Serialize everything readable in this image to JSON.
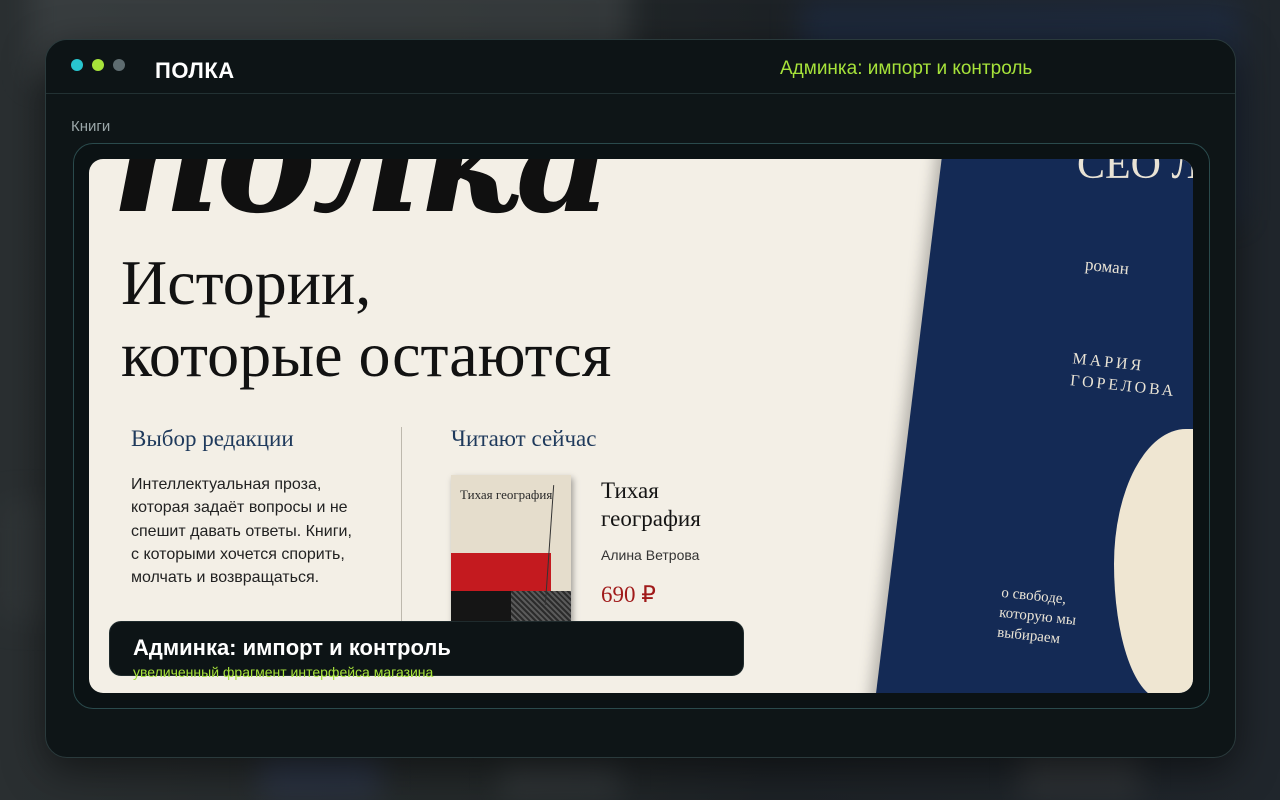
{
  "window": {
    "brand": "ПОЛКА",
    "title_right": "Админка: импорт и контроль"
  },
  "breadcrumb": "Книги",
  "screenshot": {
    "logo_text": "полка",
    "headline_line1": "Истории,",
    "headline_line2": "которые остаются",
    "editors_choice": {
      "title": "Выбор редакции",
      "text": "Интеллектуальная проза, которая задаёт вопросы и не спешит давать ответы. Книги, с которыми хочется спорить, молчать и возвращаться."
    },
    "reading_now": {
      "title": "Читают сейчас",
      "book": {
        "cover_title": "Тихая география",
        "title": "Тихая география",
        "author": "Алина Ветрова",
        "price": "690 ₽"
      }
    },
    "featured_cover": {
      "title": "СЕО ЛИН",
      "genre": "роман",
      "author": "МАРИЯ ГОРЕЛОВА",
      "tagline": "о свободе, которую мы выбираем"
    }
  },
  "caption": {
    "title": "Админка: импорт и контроль",
    "subtitle": "увеличенный фрагмент интерфейса магазина"
  },
  "colors": {
    "accent": "#a6e23a",
    "teal": "#28c6cf",
    "cover_blue": "#142a55",
    "price_red": "#a01a1a"
  }
}
